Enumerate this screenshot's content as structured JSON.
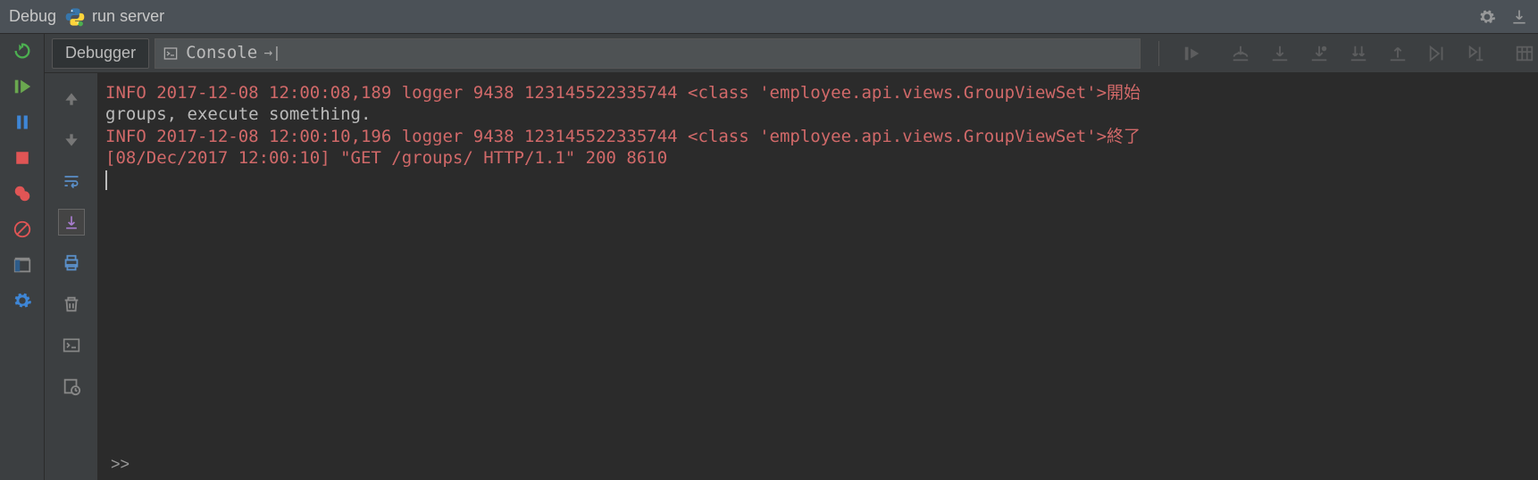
{
  "header": {
    "title": "Debug",
    "run_config": "run server"
  },
  "tabs": {
    "debugger": "Debugger",
    "console": "Console"
  },
  "console_lines": [
    {
      "cls": "red",
      "text": "INFO 2017-12-08 12:00:08,189 logger 9438 123145522335744 <class 'employee.api.views.GroupViewSet'>開始"
    },
    {
      "cls": "",
      "text": "groups, execute something."
    },
    {
      "cls": "red",
      "text": "INFO 2017-12-08 12:00:10,196 logger 9438 123145522335744 <class 'employee.api.views.GroupViewSet'>終了"
    },
    {
      "cls": "red",
      "text": "[08/Dec/2017 12:00:10] \"GET /groups/ HTTP/1.1\" 200 8610"
    }
  ],
  "more_label": ">>"
}
